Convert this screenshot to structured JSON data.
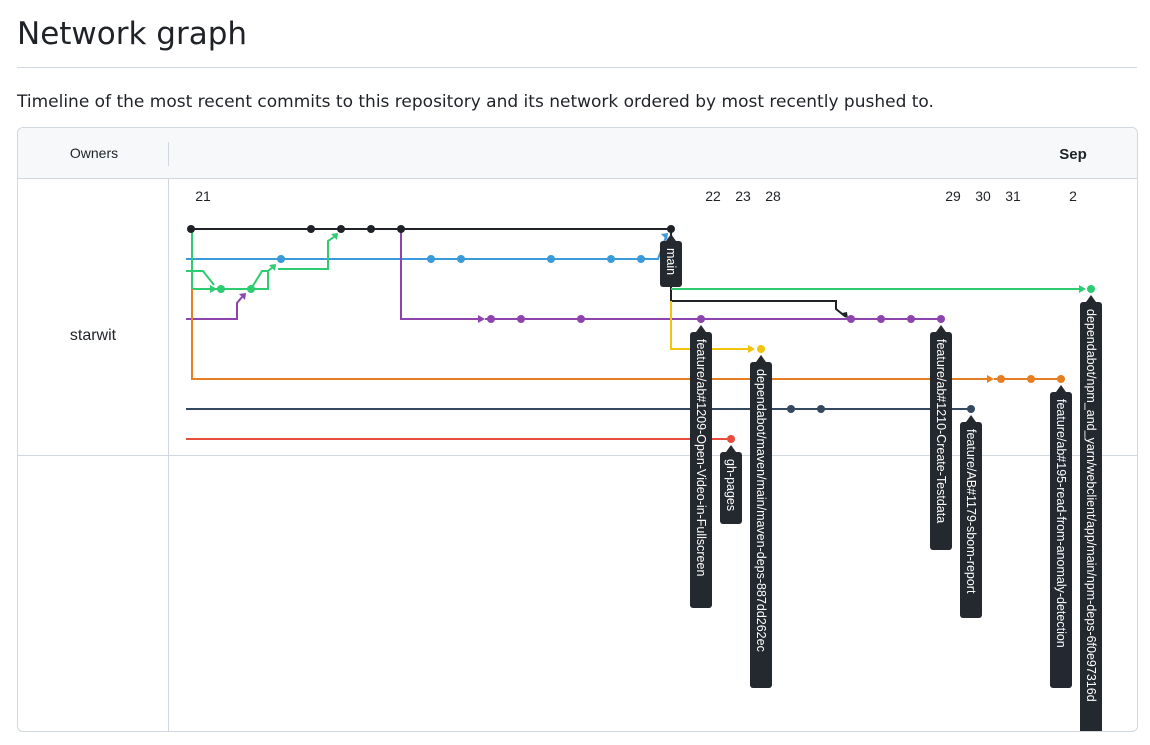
{
  "page": {
    "title": "Network graph",
    "description": "Timeline of the most recent commits to this repository and its network ordered by most recently pushed to."
  },
  "graph": {
    "owners_header": "Owners",
    "month_label": "Sep",
    "owner": "starwit",
    "dates": [
      "21",
      "22",
      "23",
      "28",
      "29",
      "30",
      "31",
      "2"
    ],
    "colors": {
      "black": "#1f2328",
      "blue": "#3b9ad9",
      "green": "#2ecc71",
      "purple": "#8e44ad",
      "yellow": "#f1c40f",
      "orange": "#e67e22",
      "slate": "#34495e",
      "red": "#e74c3c"
    },
    "branch_labels": [
      "main",
      "feature/ab#1209-Open-Video-in-Fullscreen",
      "gh-pages",
      "dependabot/maven/main/maven-deps-887dd262ec",
      "feature/ab#1210-Create-Testdata",
      "feature/AB#1179-sbom-report",
      "feature/ab#195-read-from-anomaly-detection",
      "dependabot/npm_and_yarn/webclient/app/main/npm-deps-6f0e97316d"
    ]
  }
}
